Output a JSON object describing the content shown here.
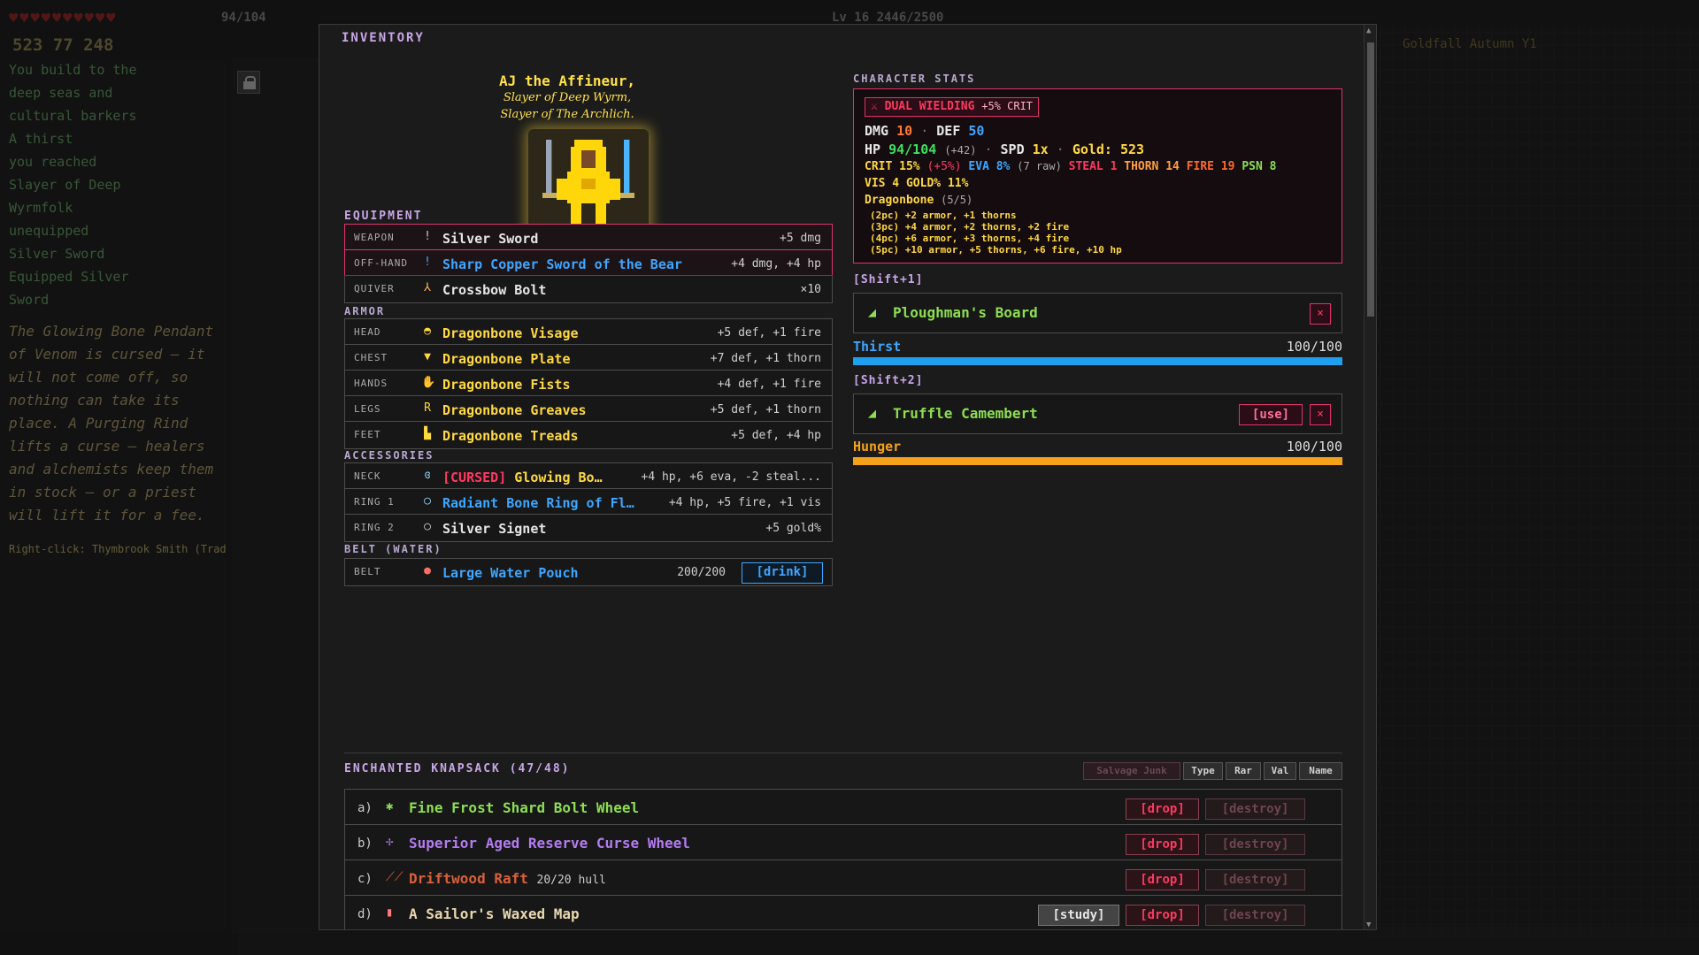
{
  "background": {
    "hud_stats": "523  77  248",
    "hud_level": "Lv 16  2446/2500",
    "hud_hp": "94/104",
    "zone_title": "Goldfall Autumn  Y1",
    "log_lines": [
      "You build to the",
      "deep seas and",
      "cultural barkers",
      "A thirst",
      "you reached",
      "Slayer of Deep",
      "Wyrmfolk",
      "unequipped",
      "Silver Sword",
      "Equipped Silver",
      "Sword"
    ],
    "log_emph": "The Glowing Bone Pendant of Venom is cursed — it will not come off, so nothing can take its place. A Purging Rind lifts a curse — healers and alchemists keep them in stock — or a priest will lift it for a fee.",
    "right_click_hint": "Right-click: Thymbrook Smith (Trade)"
  },
  "modal": {
    "title": "INVENTORY",
    "character": {
      "name": "AJ the Affineur,",
      "title1": "Slayer of Deep Wyrm,",
      "title2": "Slayer of The Archlich."
    },
    "equipment_header": "EQUIPMENT",
    "equipment": [
      {
        "label": "WEAPON",
        "icon": "!",
        "name": "Silver Sword",
        "stats": "+5 dmg"
      },
      {
        "label": "OFF-HAND",
        "icon": "!",
        "name": "Sharp Copper Sword of the Bear",
        "stats": "+4 dmg, +4 hp"
      },
      {
        "label": "QUIVER",
        "icon": "⅄",
        "name": "Crossbow Bolt",
        "stats": "×10"
      }
    ],
    "armor_header": "ARMOR",
    "armor": [
      {
        "label": "HEAD",
        "icon": "◓",
        "name": "Dragonbone Visage",
        "stats": "+5 def, +1 fire"
      },
      {
        "label": "CHEST",
        "icon": "▼",
        "name": "Dragonbone Plate",
        "stats": "+7 def, +1 thorn"
      },
      {
        "label": "HANDS",
        "icon": "✋",
        "name": "Dragonbone Fists",
        "stats": "+4 def, +1 fire"
      },
      {
        "label": "LEGS",
        "icon": "R",
        "name": "Dragonbone Greaves",
        "stats": "+5 def, +1 thorn"
      },
      {
        "label": "FEET",
        "icon": "▙",
        "name": "Dragonbone Treads",
        "stats": "+5 def, +4 hp"
      }
    ],
    "accessories_header": "ACCESSORIES",
    "accessories": [
      {
        "label": "NECK",
        "icon": "ɞ",
        "cursed": "[CURSED]",
        "name": "Glowing Bo…",
        "stats": "+4 hp, +6 eva, -2 steal..."
      },
      {
        "label": "RING 1",
        "icon": "○",
        "name": "Radiant Bone Ring of Fl…",
        "stats": "+4 hp, +5 fire, +1 vis"
      },
      {
        "label": "RING 2",
        "icon": "○",
        "name": "Silver Signet",
        "stats": "+5 gold%"
      }
    ],
    "belt_header": "BELT (WATER)",
    "belt": {
      "label": "BELT",
      "icon": "●",
      "name": "Large Water Pouch",
      "stats": "200/200",
      "button": "[drink]"
    },
    "stats_header": "CHARACTER STATS",
    "stats": {
      "dual_label": "⚔ DUAL WIELDING",
      "dual_bonus": "+5% CRIT",
      "dmg_k": "DMG",
      "dmg_v": "10",
      "def_k": "DEF",
      "def_v": "50",
      "hp_k": "HP",
      "hp_v": "94/104",
      "hp_bonus": "(+42)",
      "spd_k": "SPD",
      "spd_v": "1x",
      "gold": "Gold: 523",
      "crit_k": "CRIT",
      "crit_v": "15%",
      "crit_bonus": "(+5%)",
      "eva": "EVA 8%",
      "eva_raw": "(7 raw)",
      "steal": "STEAL 1",
      "thorn": "THORN 14",
      "fire": "FIRE 19",
      "psn": "PSN 8",
      "vis": "VIS 4",
      "goldpct": "GOLD% 11%",
      "set_name": "Dragonbone",
      "set_count": "(5/5)",
      "set_lines": [
        "(2pc) +2 armor, +1 thorns",
        "(3pc) +4 armor, +2 thorns, +2 fire",
        "(4pc) +6 armor, +3 thorns, +4 fire",
        "(5pc) +10 armor, +5 thorns, +6 fire, +10 hp"
      ]
    },
    "quick1": {
      "header": "[Shift+1]",
      "icon": "◢",
      "name": "Ploughman's Board",
      "x": "×"
    },
    "thirst": {
      "label": "Thirst",
      "value": "100/100",
      "fraction": 1.0,
      "color": "#1e9ff0"
    },
    "quick2": {
      "header": "[Shift+2]",
      "icon": "◢",
      "name": "Truffle Camembert",
      "use": "[use]",
      "x": "×"
    },
    "hunger": {
      "label": "Hunger",
      "value": "100/100",
      "fraction": 1.0,
      "color": "#f5a21a"
    },
    "knapsack": {
      "header": "ENCHANTED KNAPSACK (47/48)",
      "sort_buttons": [
        "Salvage Junk",
        "Type",
        "Rar",
        "Val",
        "Name"
      ],
      "items": [
        {
          "key": "a)",
          "icon": "✱",
          "icon_color": "#8dde52",
          "name": "Fine Frost Shard Bolt Wheel",
          "name_color": "#8dde52",
          "extra": "",
          "drop": "[drop]",
          "destroy": "[destroy]",
          "study": ""
        },
        {
          "key": "b)",
          "icon": "✢",
          "icon_color": "#b37cf0",
          "name": "Superior Aged Reserve Curse Wheel",
          "name_color": "#b37cf0",
          "extra": "",
          "drop": "[drop]",
          "destroy": "[destroy]",
          "study": ""
        },
        {
          "key": "c)",
          "icon": "⟋⟋",
          "icon_color": "#d9603a",
          "name": "Driftwood Raft",
          "name_color": "#d9603a",
          "extra": "20/20 hull",
          "drop": "[drop]",
          "destroy": "[destroy]",
          "study": ""
        },
        {
          "key": "d)",
          "icon": "▮",
          "icon_color": "#ff7a7a",
          "name": "A Sailor's Waxed Map",
          "name_color": "#e8d8b0",
          "extra": "",
          "drop": "[drop]",
          "destroy": "[destroy]",
          "study": "[study]"
        }
      ]
    }
  }
}
